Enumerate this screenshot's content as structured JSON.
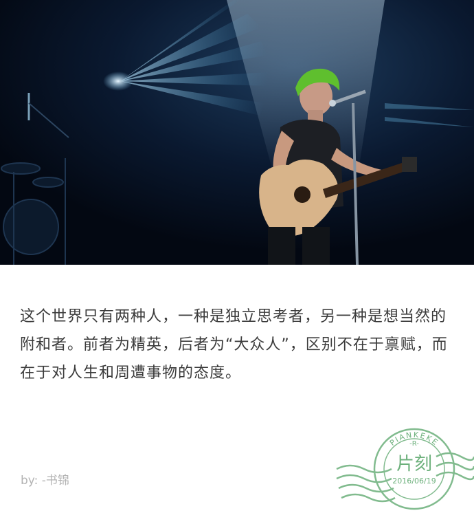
{
  "post": {
    "quote": "这个世界只有两种人，一种是独立思考者，另一种是想当然的附和者。前者为精英，后者为“大众人”，区别不在于禀赋，而在于对人生和周遭事物的态度。",
    "author": "by: -书锦"
  },
  "stamp": {
    "brand_en": "PIANKEKE",
    "brand_cn": "片刻",
    "date": "2016/06/19",
    "color": "#6cb07b"
  }
}
